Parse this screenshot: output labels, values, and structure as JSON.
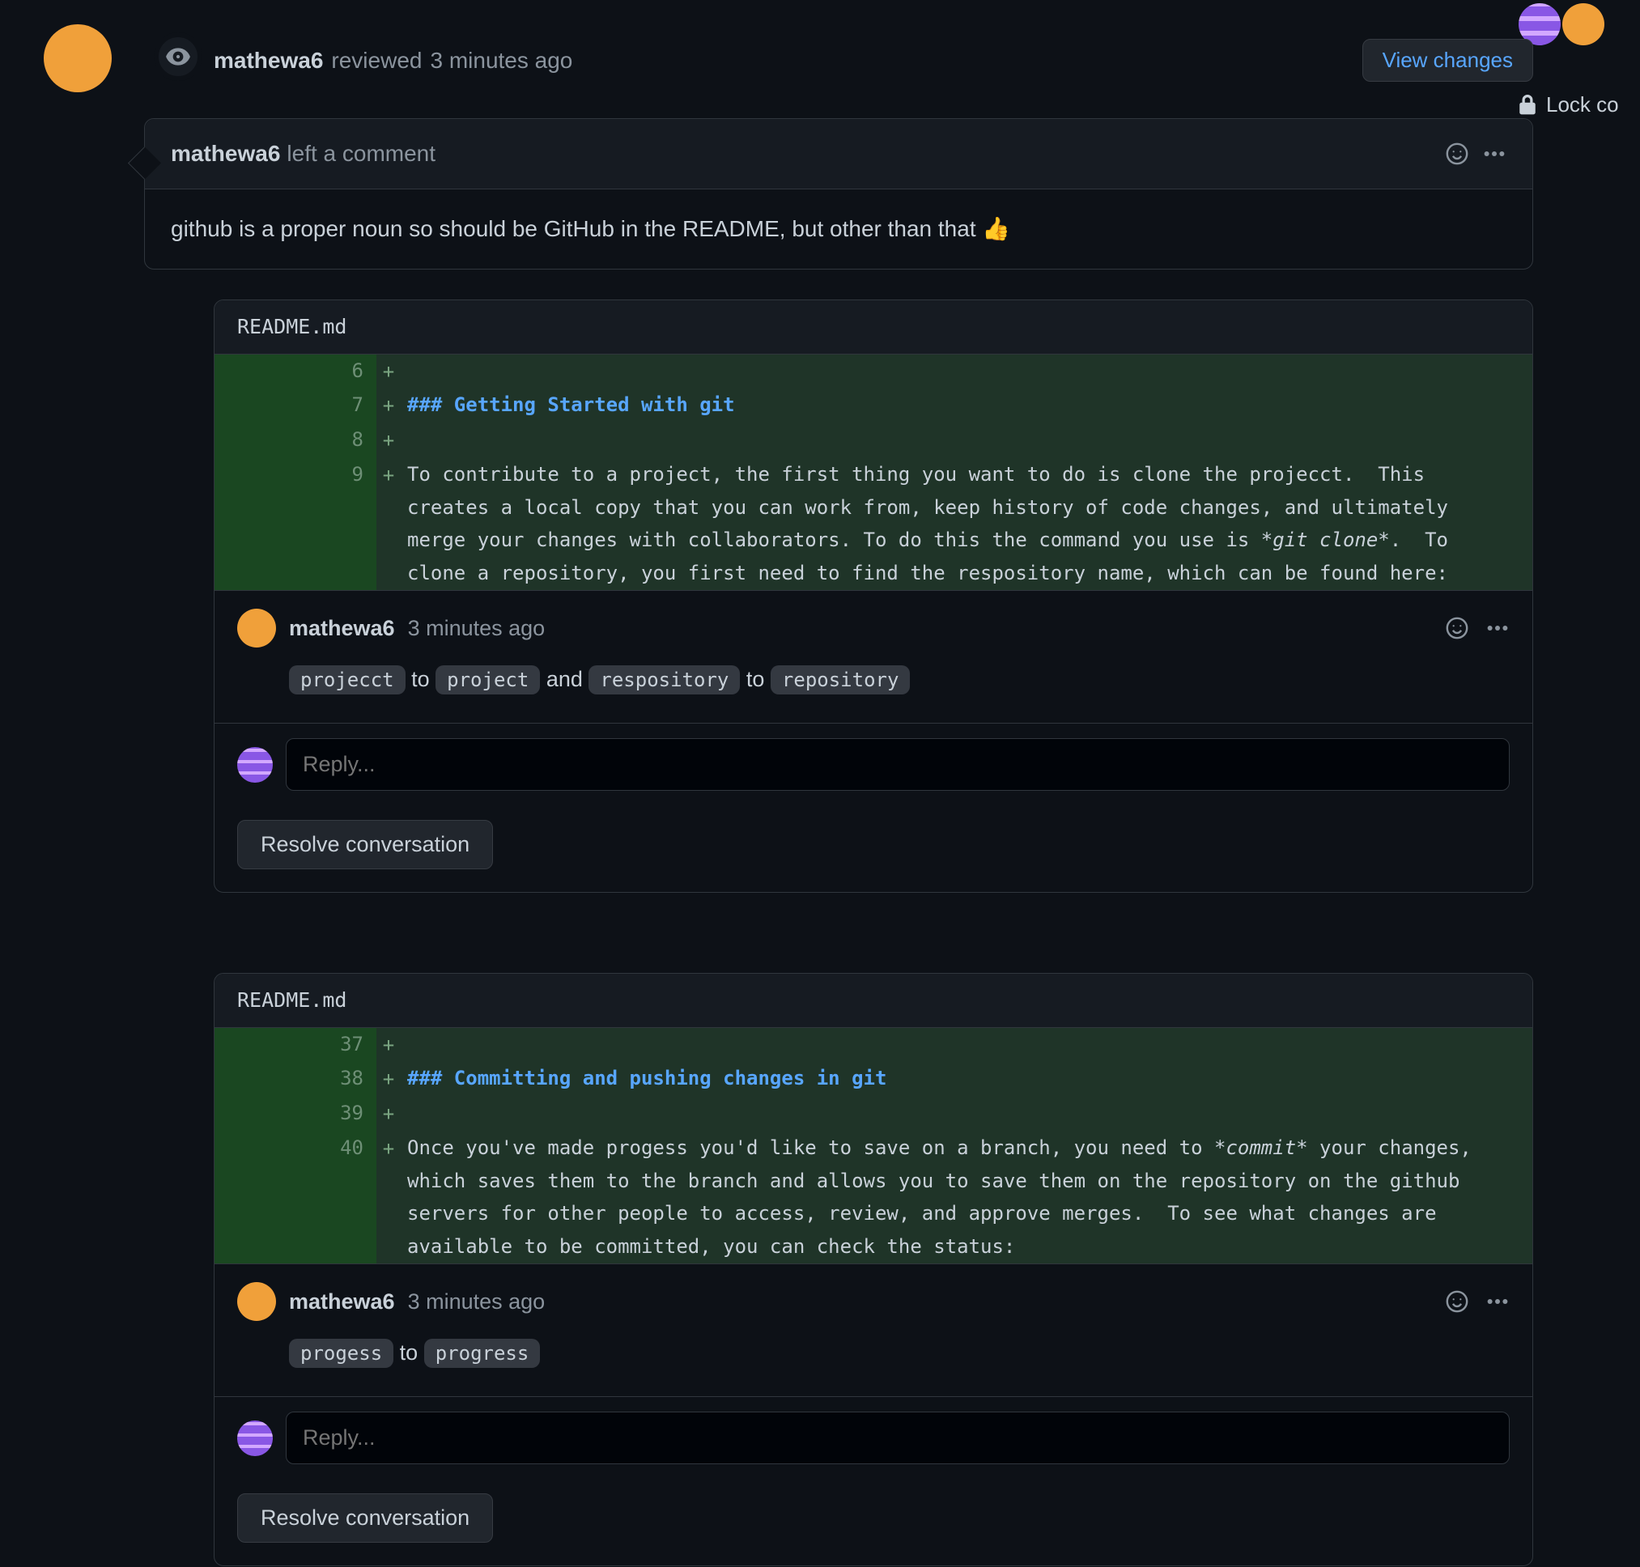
{
  "header": {
    "author": "mathewa6",
    "action_text": "reviewed",
    "time": "3 minutes ago",
    "view_changes": "View changes"
  },
  "comment": {
    "author": "mathewa6",
    "action": "left a comment",
    "body": "github is a proper noun so should be GitHub in the README, but other than that 👍"
  },
  "sidebar": {
    "lock_label": "Lock co"
  },
  "reply_placeholder": "Reply...",
  "resolve_label": "Resolve conversation",
  "card1": {
    "file": "README.md",
    "lines": [
      {
        "n": "6",
        "code": ""
      },
      {
        "n": "7",
        "code_html": "<span class='hd'>### Getting Started with git</span>"
      },
      {
        "n": "8",
        "code": ""
      },
      {
        "n": "9",
        "code_html": "To contribute to a project, the first thing you want to do is clone the projecct.  This creates a local copy that you can work from, keep history of code changes, and ultimately merge your changes with collaborators. To do this the command you use is <span class='it'>*git clone*</span>.  To clone a repository, you first need to find the respository name, which can be found here:"
      }
    ],
    "comment": {
      "author": "mathewa6",
      "time": "3 minutes ago",
      "w1": "projecct",
      "t1": "to",
      "w2": "project",
      "a1": "and",
      "w3": "respository",
      "t2": "to",
      "w4": "repository"
    }
  },
  "card2": {
    "file": "README.md",
    "lines": [
      {
        "n": "37",
        "code": ""
      },
      {
        "n": "38",
        "code_html": "<span class='hd'>### Committing and pushing changes in git</span>"
      },
      {
        "n": "39",
        "code": ""
      },
      {
        "n": "40",
        "code_html": "Once you've made progess you'd like to save on a branch, you need to <span class='it'>*commit*</span> your changes, which saves them to the branch and allows you to save them on the repository on the github servers for other people to access, review, and approve merges.  To see what changes are available to be committed, you can check the status:"
      }
    ],
    "comment": {
      "author": "mathewa6",
      "time": "3 minutes ago",
      "w1": "progess",
      "t1": "to",
      "w2": "progress"
    }
  }
}
